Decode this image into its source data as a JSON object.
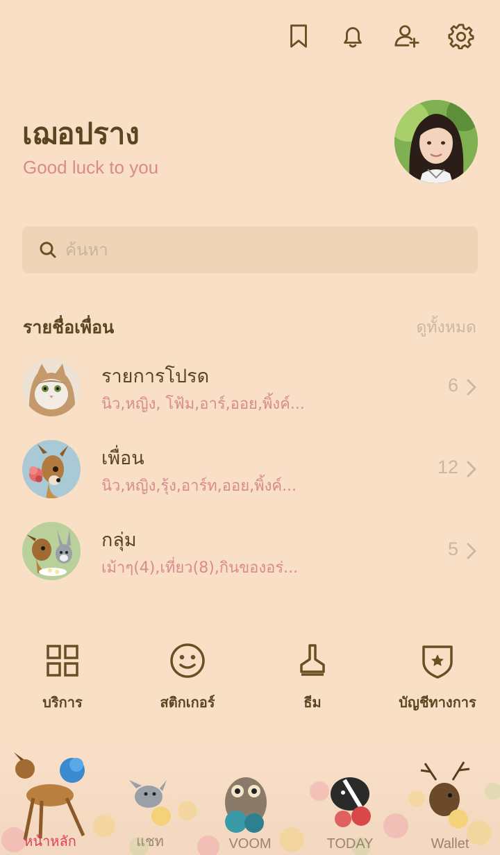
{
  "header": {
    "icons": [
      "bookmark-icon",
      "bell-icon",
      "add-friend-icon",
      "gear-icon"
    ]
  },
  "profile": {
    "name": "เฌอปราง",
    "status": "Good luck to you"
  },
  "search": {
    "placeholder": "ค้นหา"
  },
  "friends_section": {
    "title": "รายชื่อเพื่อน",
    "see_all": "ดูทั้งหมด",
    "rows": [
      {
        "title": "รายการโปรด",
        "subtitle": "นิว,หญิง, โฟ้ม,อาร์,ออย,พิ้งค์...",
        "count": "6"
      },
      {
        "title": "เพื่อน",
        "subtitle": "นิว,หญิง,รุ้ง,อาร์ท,ออย,พิ้งค์...",
        "count": "12"
      },
      {
        "title": "กลุ่ม",
        "subtitle": "เม้าๆ(4),เที่ยว(8),กินของอร่...",
        "count": "5"
      }
    ]
  },
  "shortcuts": [
    {
      "label": "บริการ",
      "icon": "grid-icon"
    },
    {
      "label": "สติกเกอร์",
      "icon": "smiley-icon"
    },
    {
      "label": "ธีม",
      "icon": "brush-icon"
    },
    {
      "label": "บัญชีทางการ",
      "icon": "shield-star-icon"
    }
  ],
  "bottom_nav": [
    {
      "label": "หน้าหลัก",
      "active": true
    },
    {
      "label": "แชท",
      "active": false
    },
    {
      "label": "VOOM",
      "active": false
    },
    {
      "label": "TODAY",
      "active": false
    },
    {
      "label": "Wallet",
      "active": false
    }
  ],
  "colors": {
    "background": "#f8dfc6",
    "accent_text": "#d88b8e",
    "icon": "#6b4e22",
    "active_nav": "#e0405a"
  }
}
